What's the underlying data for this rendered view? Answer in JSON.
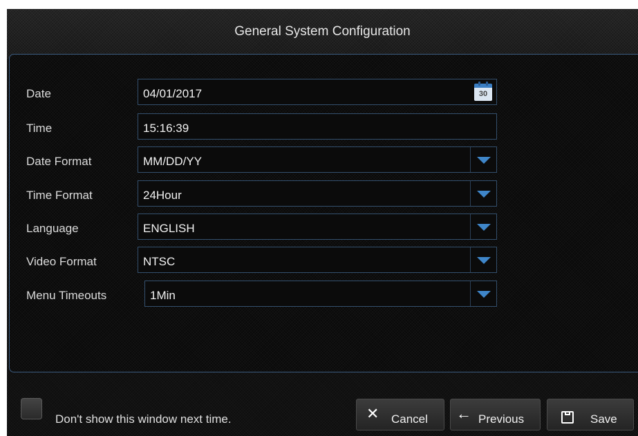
{
  "window": {
    "title": "General System Configuration"
  },
  "form": {
    "date": {
      "label": "Date",
      "value": "04/01/2017",
      "calendar_day": "30"
    },
    "time": {
      "label": "Time",
      "value": "15:16:39"
    },
    "date_format": {
      "label": "Date Format",
      "value": "MM/DD/YY"
    },
    "time_format": {
      "label": "Time Format",
      "value": "24Hour"
    },
    "language": {
      "label": "Language",
      "value": "ENGLISH"
    },
    "video_format": {
      "label": "Video Format",
      "value": "NTSC"
    },
    "menu_timeouts": {
      "label": "Menu Timeouts",
      "value": "1Min"
    }
  },
  "footer": {
    "dont_show_label": "Don't show this window next time.",
    "dont_show_checked": false,
    "cancel_label": "Cancel",
    "previous_label": "Previous",
    "save_label": "Save"
  },
  "colors": {
    "accent_blue": "#3f86c9",
    "field_border": "#34506e",
    "background": "#0e0e0e"
  },
  "icons": {
    "date": "calendar-icon",
    "dropdowns": "chevron-down-icon",
    "cancel": "close-icon",
    "previous": "arrow-left-icon",
    "save": "floppy-disk-icon"
  }
}
